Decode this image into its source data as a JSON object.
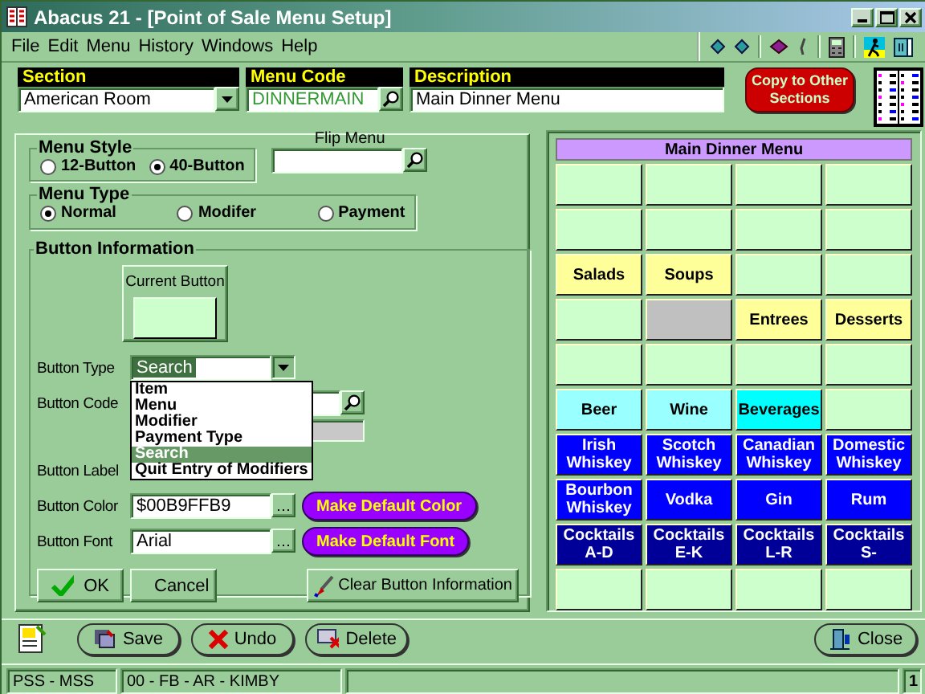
{
  "window": {
    "title": "Abacus 21 - [Point of Sale Menu Setup]"
  },
  "menu_bar": [
    "File",
    "Edit",
    "Menu",
    "History",
    "Windows",
    "Help"
  ],
  "header_fields": [
    {
      "label": "Section",
      "value": "American Room",
      "kind": "dropdown"
    },
    {
      "label": "Menu Code",
      "value": "DINNERMAIN",
      "kind": "lookup"
    },
    {
      "label": "Description",
      "value": "Main Dinner Menu",
      "kind": "text"
    }
  ],
  "copy_button": "Copy to Other Sections",
  "menu_style": {
    "label": "Menu Style",
    "options": [
      {
        "label": "12-Button",
        "selected": false
      },
      {
        "label": "40-Button",
        "selected": true
      }
    ]
  },
  "flip_menu": {
    "label": "Flip Menu"
  },
  "menu_type": {
    "label": "Menu Type",
    "options": [
      {
        "label": "Normal",
        "selected": true
      },
      {
        "label": "Modifer",
        "selected": false
      },
      {
        "label": "Payment",
        "selected": false
      }
    ]
  },
  "button_information": {
    "label": "Button Information",
    "current_button": {
      "label": "Current Button",
      "color": "#ccffcc"
    },
    "button_type": {
      "label": "Button Type",
      "value": "Search",
      "expanded": true,
      "options": [
        {
          "label": "Item",
          "selected": false
        },
        {
          "label": "Menu",
          "selected": false
        },
        {
          "label": "Modifier",
          "selected": false
        },
        {
          "label": "Payment Type",
          "selected": false
        },
        {
          "label": "Search",
          "selected": true
        },
        {
          "label": "Quit Entry of Modifiers",
          "selected": false
        }
      ]
    },
    "button_code": {
      "label": "Button Code"
    },
    "button_label": {
      "label": "Button Label"
    },
    "button_color": {
      "label": "Button Color",
      "value": "$00B9FFB9",
      "action": "Make Default Color"
    },
    "button_font": {
      "label": "Button Font",
      "value": "Arial",
      "action": "Make Default Font"
    },
    "ok": "OK",
    "cancel": "Cancel",
    "clear": "Clear Button Information"
  },
  "menu_grid": {
    "title": "Main Dinner Menu",
    "buttons": [
      {
        "color": "#ccffcc"
      },
      {
        "color": "#ccffcc"
      },
      {
        "color": "#ccffcc"
      },
      {
        "color": "#ccffcc"
      },
      {
        "color": "#ccffcc"
      },
      {
        "color": "#ccffcc"
      },
      {
        "color": "#ccffcc"
      },
      {
        "color": "#ccffcc"
      },
      {
        "label": "Salads",
        "color": "#ffff99"
      },
      {
        "label": "Soups",
        "color": "#ffff99"
      },
      {
        "color": "#ccffcc"
      },
      {
        "color": "#ccffcc"
      },
      {
        "color": "#ccffcc"
      },
      {
        "color": "#c0c0c0"
      },
      {
        "label": "Entrees",
        "color": "#ffff99"
      },
      {
        "label": "Desserts",
        "color": "#ffff99"
      },
      {
        "color": "#ccffcc"
      },
      {
        "color": "#ccffcc"
      },
      {
        "color": "#ccffcc"
      },
      {
        "color": "#ccffcc"
      },
      {
        "label": "Beer",
        "color": "#99ffff"
      },
      {
        "label": "Wine",
        "color": "#99ffff"
      },
      {
        "label": "Beverages",
        "color": "#00ffff"
      },
      {
        "color": "#ccffcc"
      },
      {
        "label": "Irish Whiskey",
        "color": "#0000ff"
      },
      {
        "label": "Scotch Whiskey",
        "color": "#0000ff"
      },
      {
        "label": "Canadian Whiskey",
        "color": "#0000ff"
      },
      {
        "label": "Domestic Whiskey",
        "color": "#0000ff"
      },
      {
        "label": "Bourbon Whiskey",
        "color": "#0000ff"
      },
      {
        "label": "Vodka",
        "color": "#0000ff"
      },
      {
        "label": "Gin",
        "color": "#0000ff"
      },
      {
        "label": "Rum",
        "color": "#0000ff"
      },
      {
        "label": "Cocktails A-D",
        "color": "#000099"
      },
      {
        "label": "Cocktails E-K",
        "color": "#000099"
      },
      {
        "label": "Cocktails L-R",
        "color": "#000099"
      },
      {
        "label": "Cocktails S-",
        "color": "#000099"
      },
      {
        "color": "#ccffcc"
      },
      {
        "color": "#ccffcc"
      },
      {
        "color": "#ccffcc"
      },
      {
        "color": "#ccffcc"
      }
    ]
  },
  "bottom_buttons": [
    {
      "label": "Save",
      "kind": "save"
    },
    {
      "label": "Undo",
      "kind": "undo"
    },
    {
      "label": "Delete",
      "kind": "delete"
    },
    {
      "label": "Close",
      "kind": "close"
    }
  ],
  "status_bar": {
    "panels": [
      "PSS - MSS",
      "00 - FB - AR - KIMBY"
    ],
    "page": "1"
  }
}
